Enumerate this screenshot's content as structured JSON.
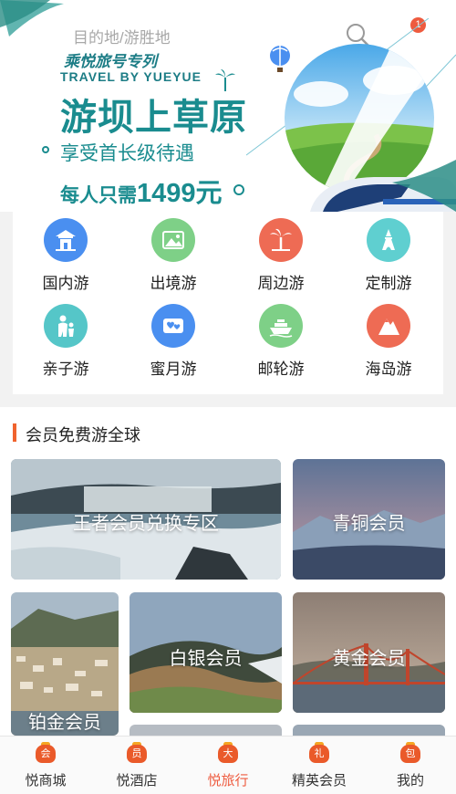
{
  "banner": {
    "search_placeholder": "目的地/游胜地",
    "notification_count": "1",
    "series": "乘悦旅号专列",
    "series_en": "TRAVEL BY YUEYUE",
    "title": "游坝上草原",
    "subtitle": "享受首长级待遇",
    "price_prefix": "每人只需",
    "price_value": "1499元"
  },
  "categories": [
    {
      "label": "国内游",
      "icon": "temple-icon",
      "color": "#4a8ff0"
    },
    {
      "label": "出境游",
      "icon": "landscape-icon",
      "color": "#7ed087"
    },
    {
      "label": "周边游",
      "icon": "palm-tree-icon",
      "color": "#ee6b54"
    },
    {
      "label": "定制游",
      "icon": "tower-icon",
      "color": "#5fcfd0"
    },
    {
      "label": "亲子游",
      "icon": "family-icon",
      "color": "#55c6c8"
    },
    {
      "label": "蜜月游",
      "icon": "hearts-icon",
      "color": "#4a8ff0"
    },
    {
      "label": "邮轮游",
      "icon": "cruise-ship-icon",
      "color": "#7ed087"
    },
    {
      "label": "海岛游",
      "icon": "mountain-icon",
      "color": "#ee6b54"
    }
  ],
  "membership": {
    "section_title": "会员免费游全球",
    "cards": [
      {
        "label": "王者会员兑换专区"
      },
      {
        "label": "青铜会员"
      },
      {
        "label": "铂金会员"
      },
      {
        "label": "白银会员"
      },
      {
        "label": "黄金会员"
      }
    ]
  },
  "tabbar": {
    "active": "悦旅行",
    "accent": "#ee5b3f",
    "tabs": [
      {
        "label": "悦商城",
        "glyph": "会"
      },
      {
        "label": "悦酒店",
        "glyph": "员"
      },
      {
        "label": "悦旅行",
        "glyph": "大"
      },
      {
        "label": "精英会员",
        "glyph": "礼"
      },
      {
        "label": "我的",
        "glyph": "包"
      }
    ]
  }
}
